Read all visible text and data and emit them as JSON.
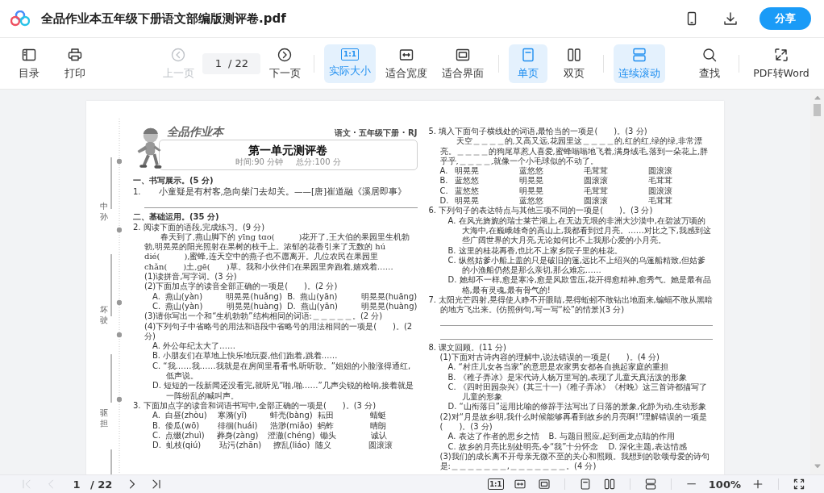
{
  "window": {
    "title": "全品作业本五年级下册语文部编版测评卷.pdf",
    "share_button": "分享"
  },
  "toolbar": {
    "groups": [
      [
        {
          "kind": "button",
          "label": "目录",
          "selected": false,
          "disabled": false
        },
        {
          "kind": "button",
          "label": "打印",
          "selected": false,
          "disabled": false
        }
      ],
      [
        {
          "kind": "button",
          "label": "上一页",
          "selected": false,
          "disabled": true
        },
        {
          "kind": "page_field",
          "value": "1",
          "separator": "/",
          "total": "22"
        },
        {
          "kind": "button",
          "label": "下一页",
          "selected": false,
          "disabled": false
        }
      ],
      [
        {
          "kind": "button",
          "label": "实际大小",
          "badge": "1:1",
          "selected": true,
          "disabled": false
        },
        {
          "kind": "button",
          "label": "适合宽度",
          "selected": false,
          "disabled": false
        },
        {
          "kind": "button",
          "label": "适合界面",
          "selected": false,
          "disabled": false
        }
      ],
      [
        {
          "kind": "button",
          "label": "单页",
          "selected": true,
          "disabled": false
        },
        {
          "kind": "button",
          "label": "双页",
          "selected": false,
          "disabled": false
        }
      ],
      [
        {
          "kind": "button",
          "label": "连续滚动",
          "selected": true,
          "disabled": false
        }
      ],
      [
        {
          "kind": "button",
          "label": "查找",
          "selected": false,
          "disabled": false
        }
      ],
      [
        {
          "kind": "button",
          "label": "PDF转Word",
          "selected": false,
          "disabled": false
        }
      ]
    ]
  },
  "document": {
    "binding_labels": [
      "中孙",
      "坏驶",
      "驱担"
    ],
    "brand": "全品作业本",
    "subject": "语文 · 五年级下册 · RJ",
    "title": "第一单元测评卷",
    "meta": [
      "时间:90 分钟",
      "总分:100 分"
    ],
    "left": [
      {
        "kind": "section",
        "text": "一、书写展示。(5 分)"
      },
      {
        "kind": "poem",
        "number": "1.",
        "text": "小童疑是有村客,急向柴门去却关。——[唐]崔道融《溪居即事》"
      },
      {
        "kind": "rule"
      },
      {
        "kind": "section",
        "text": "二、基础运用。(35 分)"
      },
      {
        "kind": "question",
        "text": "2. 阅读下面的语段,完成练习。(9 分)"
      },
      {
        "kind": "para",
        "text": "春天到了,燕山脚下的 yīng tɑo(　　　)花开了,王大伯的果园里生机勃勃,明晃晃的阳光照射在果树的枝干上。浓郁的花香引来了无数的 hú dié(　　　),蜜蜂,连天空中的燕子也不愿离开。几位农民在果园里 chǎn(　　)土,gē(　　)草。我和小伙伴们在果园里奔跑着,嬉戏着……"
      },
      {
        "kind": "sub",
        "text": "(1)读拼音,写字词。(3 分)"
      },
      {
        "kind": "sub",
        "text": "(2)下面加点字的读音全部正确的一项是(　　)。(2 分)"
      },
      {
        "kind": "options",
        "cells": [
          "A.",
          "燕山(yàn)",
          "明晃晃(huǎng)",
          "B.",
          "燕山(yān)",
          "明晃晃(huāng)"
        ]
      },
      {
        "kind": "options",
        "cells": [
          "C.",
          "燕山(yàn)",
          "明晃晃(huàng)",
          "D.",
          "燕山(yān)",
          "明晃晃(huàng)"
        ]
      },
      {
        "kind": "sub",
        "text": "(3)请你写出一个和“生机勃勃”结构相同的词语:＿＿＿＿＿。(2 分)"
      },
      {
        "kind": "sub",
        "text": "(4)下列句子中省略号的用法和语段中省略号的用法相同的一项是(　　)。(2 分)"
      },
      {
        "kind": "choice",
        "text": "A. 外公年纪太大了……"
      },
      {
        "kind": "choice",
        "text": "B. 小朋友们在草地上快乐地玩耍,他们跑着,跳着……"
      },
      {
        "kind": "choice",
        "text": "C. “我……我……我就是在房间里看看书,听听歌。”姐姐的小脸涨得通红,低声说。"
      },
      {
        "kind": "choice",
        "text": "D. 短短的一段新闻还没看完,就听见“啪,啪……”几声尖锐的枪响,接着就是一阵纷乱的喊叫声。"
      },
      {
        "kind": "question",
        "text": "3. 下面加点字的读音和词语书写中,全部正确的一项是(　　)。(3 分)"
      },
      {
        "kind": "options",
        "cells": [
          "A.",
          "白昼(zhòu)",
          "寒漪(yī)",
          "蚌壳(bàng)",
          "耘田",
          "蜻蜓"
        ]
      },
      {
        "kind": "options",
        "cells": [
          "B.",
          "倭瓜(wō)",
          "徘徊(huái)",
          "浩渺(miǎo)",
          "蚂蚱",
          "晴朗"
        ]
      },
      {
        "kind": "options",
        "cells": [
          "C.",
          "点缀(zhuì)",
          "葬身(zàng)",
          "澄澈(chéng)",
          "锄头",
          "诚认"
        ]
      },
      {
        "kind": "options",
        "cells": [
          "D.",
          "虬枝(qiú)",
          "玷污(zhān)",
          "撩乱(liáo)",
          "随义",
          "圆滚滚"
        ]
      }
    ],
    "right": [
      {
        "kind": "question",
        "text": "5. 填入下面句子横线处的词语,最恰当的一项是(　　)。(3 分)"
      },
      {
        "kind": "para",
        "text": "天空＿＿＿＿的,又高又远,花园里这＿＿＿＿的,红的红,绿的绿,非常漂亮。＿＿＿＿的狗尾草惹人喜爱,蜜蜂嗡嗡地飞着,满身绒毛,落到一朵花上,胖乎乎,＿＿＿＿,就像一个小毛球似的不动了。"
      },
      {
        "kind": "options",
        "cells": [
          "A.",
          "明晃晃",
          "蓝悠悠",
          "毛茸茸",
          "圆滚滚"
        ]
      },
      {
        "kind": "options",
        "cells": [
          "B.",
          "蓝悠悠",
          "明晃晃",
          "圆滚滚",
          "毛茸茸"
        ]
      },
      {
        "kind": "options",
        "cells": [
          "C.",
          "蓝悠悠",
          "明晃晃",
          "毛茸茸",
          "圆滚滚"
        ]
      },
      {
        "kind": "options",
        "cells": [
          "D.",
          "明晃晃",
          "蓝悠悠",
          "圆滚滚",
          "毛茸茸"
        ]
      },
      {
        "kind": "question",
        "text": "6. 下列句子的表达特点与其他三项不同的一项是(　　)。(3 分)"
      },
      {
        "kind": "choice",
        "text": "A. 在风光旖旎的瑞士莱芒湖上,在无边无垠的非洲大沙漠中,在碧波万顷的大海中,在巍峨雄奇的高山上,我都看到过月亮。……对比之下,我感到这些广阔世界的大月亮,无论如何比不上我那心爱的小月亮。"
      },
      {
        "kind": "choice",
        "text": "B. 这里的桂花再香,也比不上家乡院子里的桂花。"
      },
      {
        "kind": "choice",
        "text": "C. 纵然姑爹小船上盖的只是破旧的篷,远比不上绍兴的乌篷船精致,但姑爹的小渔船仍然是那么亲切,那么难忘……"
      },
      {
        "kind": "choice",
        "text": "D. 她却不一样,愈是寒冷,愈是风欺雪压,花开得愈精神,愈秀气。她是最有品格,最有灵魂,最有骨气的!"
      },
      {
        "kind": "question",
        "text": "7. 太阳光芒四射,晃得使人睁不开眼睛,晃得蚯蚓不敢钻出地面来,蝙蝠不敢从黑暗的地方飞出来。(仿照例句,写一写“松”的情景)(3 分)"
      },
      {
        "kind": "rule"
      },
      {
        "kind": "rule"
      },
      {
        "kind": "question",
        "text": "8. 课文回顾。(11 分)"
      },
      {
        "kind": "sub",
        "text": "(1)下面对古诗内容的理解中,说法错误的一项是(　　)。(4 分)"
      },
      {
        "kind": "choice",
        "text": "A. “村庄儿女各当家”的意思是农家男女都各自挑起家庭的重担"
      },
      {
        "kind": "choice",
        "text": "B. 《稚子弄冰》是宋代诗人杨万里写的,表现了儿童天真活泼的形象"
      },
      {
        "kind": "choice",
        "text": "C. 《四时田园杂兴》(其三十一)《稚子弄冰》《村晚》这三首诗都描写了儿童的形象"
      },
      {
        "kind": "choice",
        "text": "D. “山衔落日”运用比喻的修辞手法写出了日落的景象,化静为动,生动形象"
      },
      {
        "kind": "sub",
        "text": "(2)对“月是故乡明,我什么时候能够再看到故乡的月亮啊!”理解错误的一项是(　　)。(3 分)"
      },
      {
        "kind": "options",
        "cells": [
          "A. 表达了作者的思乡之情",
          "B. 与题目照应,起到画龙点睛的作用"
        ]
      },
      {
        "kind": "options",
        "cells": [
          "C. 故乡的月亮比别处明亮,令“我”十分怀念",
          "D. 深化主题,表达情感"
        ]
      },
      {
        "kind": "sub",
        "text": "(3)我们的成长离不开母亲无微不至的关心和照顾。我想到的歌颂母爱的诗句是:＿＿＿＿＿＿＿,＿＿＿＿＿＿＿。(4 分)"
      }
    ]
  },
  "bottom_bar": {
    "nav_buttons": [
      {
        "disabled": true
      },
      {
        "disabled": true
      },
      {
        "disabled": false
      },
      {
        "disabled": false
      }
    ],
    "page": {
      "value": "1",
      "separator": "/",
      "total": "22"
    },
    "actual_badge": "1:1",
    "zoom": "100%"
  }
}
